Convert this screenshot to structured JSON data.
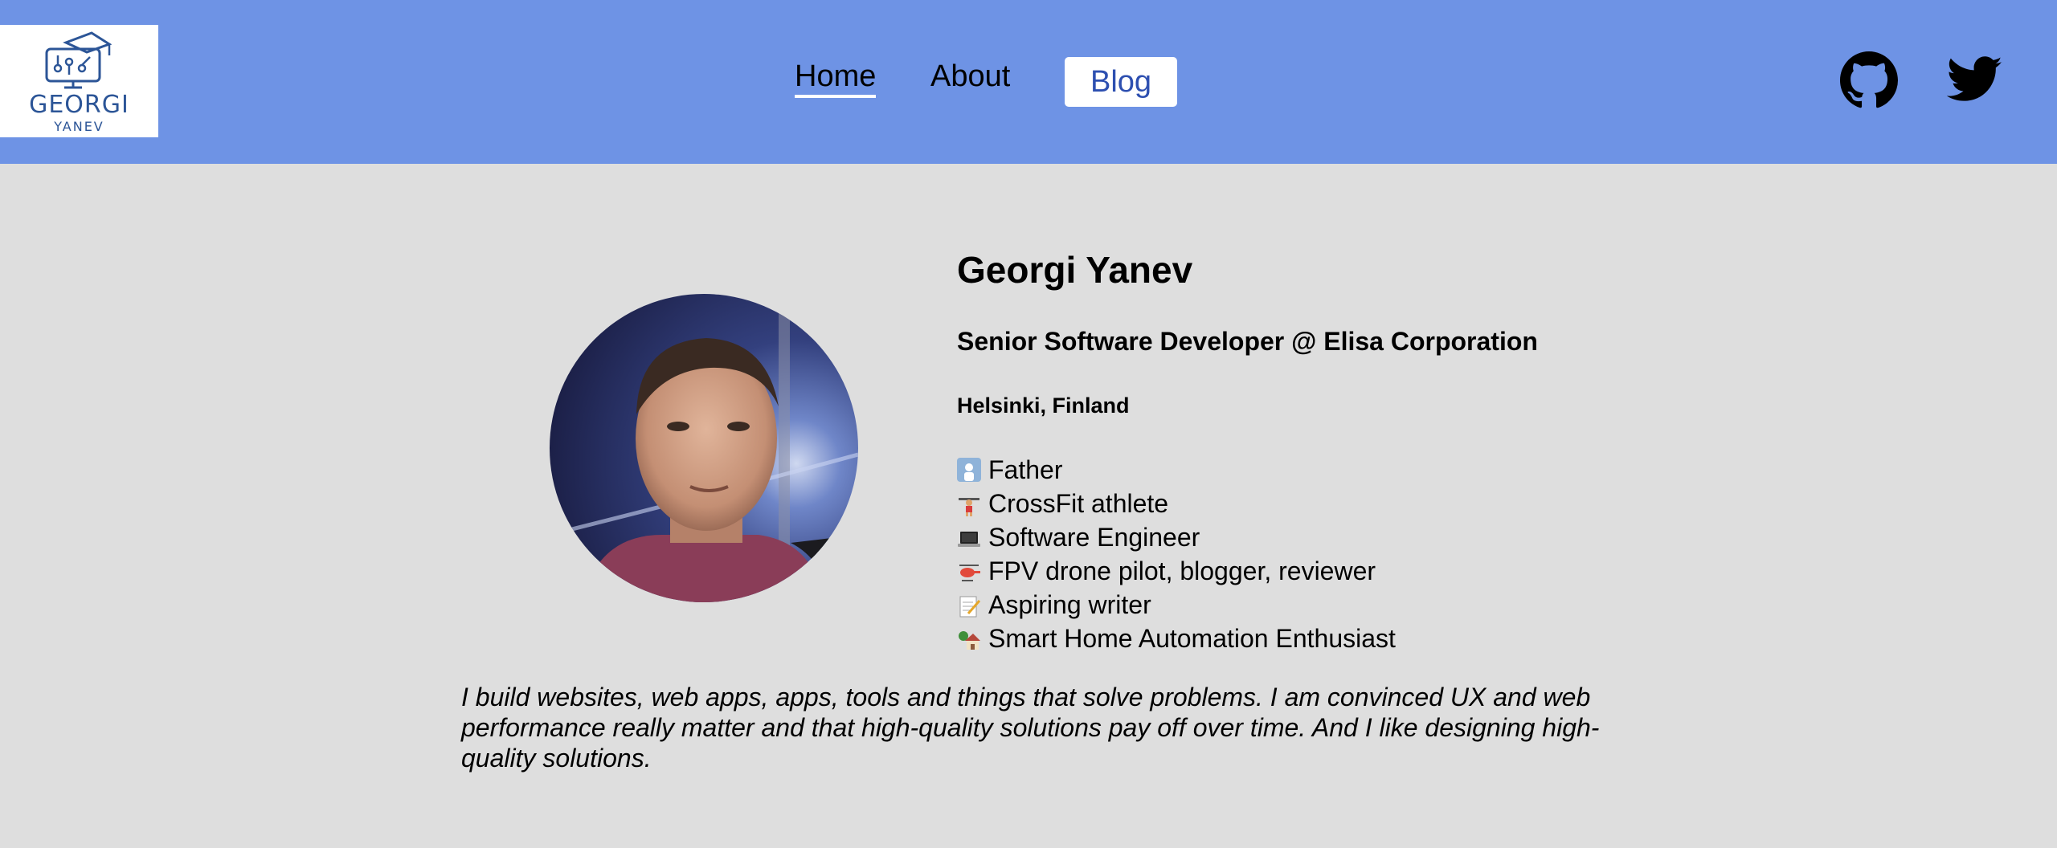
{
  "header": {
    "logo": {
      "main": "GEORGI",
      "sub": "YANEV"
    },
    "nav": {
      "home": "Home",
      "about": "About",
      "blog": "Blog"
    },
    "social": {
      "github_icon": "github-icon",
      "twitter_icon": "twitter-icon"
    },
    "background_color": "#6e93e5"
  },
  "profile": {
    "name": "Georgi Yanev",
    "role": "Senior Software Developer @ Elisa Corporation",
    "location": "Helsinki, Finland",
    "facts": [
      {
        "icon": "father-icon",
        "label": "Father"
      },
      {
        "icon": "weightlifter-icon",
        "label": "CrossFit athlete"
      },
      {
        "icon": "laptop-icon",
        "label": "Software Engineer"
      },
      {
        "icon": "helicopter-icon",
        "label": "FPV drone pilot, blogger, reviewer"
      },
      {
        "icon": "memo-icon",
        "label": "Aspiring writer"
      },
      {
        "icon": "house-icon",
        "label": "Smart Home Automation Enthusiast"
      }
    ],
    "bio": "I build websites, web apps, apps, tools and things that solve problems. I am convinced UX and web performance really matter and that high-quality solutions pay off over time. And I like designing high-quality solutions."
  },
  "colors": {
    "page_background": "#dedede",
    "accent_text": "#2d4fb0",
    "logo_text": "#2c5597"
  }
}
